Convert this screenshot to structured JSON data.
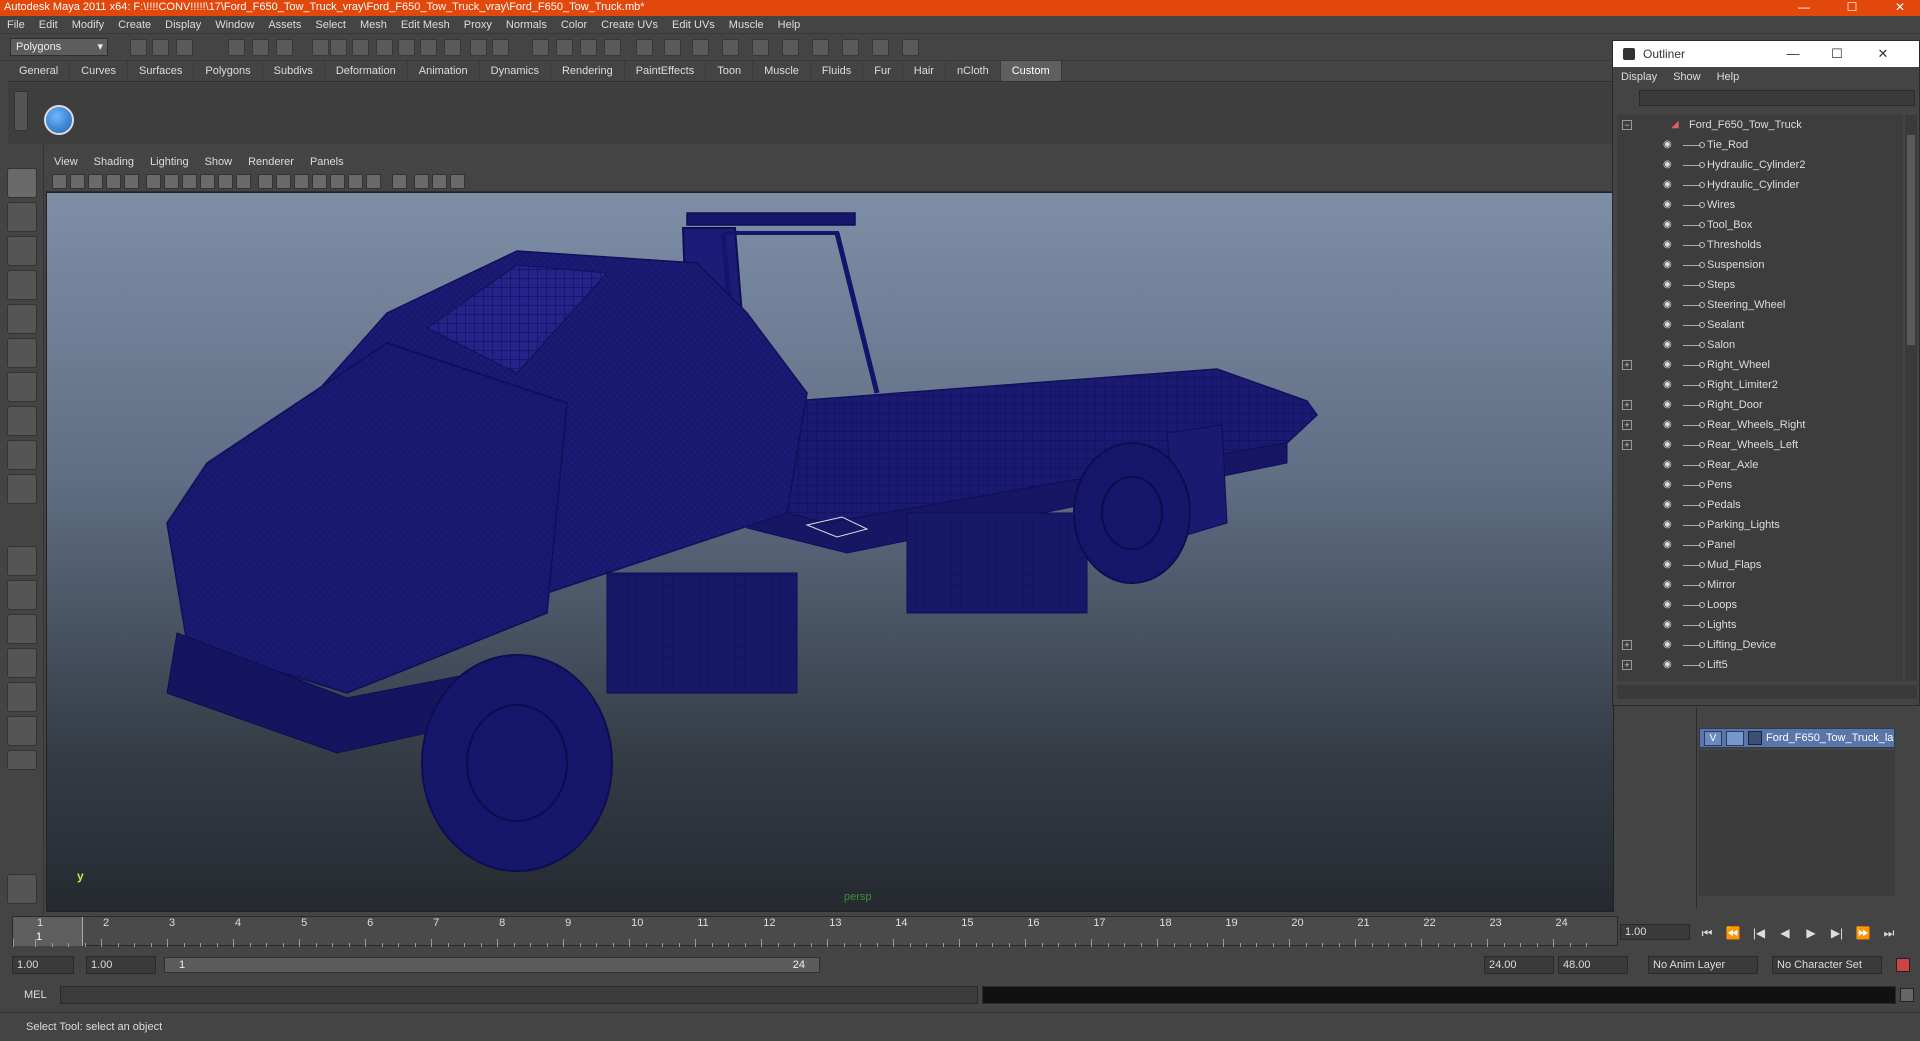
{
  "window": {
    "title": "Autodesk Maya 2011 x64: F:\\!!!!CONV!!!!!\\17\\Ford_F650_Tow_Truck_vray\\Ford_F650_Tow_Truck_vray\\Ford_F650_Tow_Truck.mb*",
    "minimize": "—",
    "maximize": "☐",
    "close": "✕"
  },
  "menubar": [
    "File",
    "Edit",
    "Modify",
    "Create",
    "Display",
    "Window",
    "Assets",
    "Select",
    "Mesh",
    "Edit Mesh",
    "Proxy",
    "Normals",
    "Color",
    "Create UVs",
    "Edit UVs",
    "Muscle",
    "Help"
  ],
  "status_line": {
    "mode": "Polygons"
  },
  "shelf": {
    "tabs": [
      "General",
      "Curves",
      "Surfaces",
      "Polygons",
      "Subdivs",
      "Deformation",
      "Animation",
      "Dynamics",
      "Rendering",
      "PaintEffects",
      "Toon",
      "Muscle",
      "Fluids",
      "Fur",
      "Hair",
      "nCloth",
      "Custom"
    ],
    "active_tab": "Custom"
  },
  "viewport": {
    "menu": [
      "View",
      "Shading",
      "Lighting",
      "Show",
      "Renderer",
      "Panels"
    ],
    "camera_label": "persp",
    "axis_label": "y",
    "wire_color": "#1a1a6e"
  },
  "outliner": {
    "title": "Outliner",
    "menu": [
      "Display",
      "Show",
      "Help"
    ],
    "root": "Ford_F650_Tow_Truck",
    "items": [
      {
        "label": "Tie_Rod",
        "expandable": false
      },
      {
        "label": "Hydraulic_Cylinder2",
        "expandable": false
      },
      {
        "label": "Hydraulic_Cylinder",
        "expandable": false
      },
      {
        "label": "Wires",
        "expandable": false
      },
      {
        "label": "Tool_Box",
        "expandable": false
      },
      {
        "label": "Thresholds",
        "expandable": false
      },
      {
        "label": "Suspension",
        "expandable": false
      },
      {
        "label": "Steps",
        "expandable": false
      },
      {
        "label": "Steering_Wheel",
        "expandable": false
      },
      {
        "label": "Sealant",
        "expandable": false
      },
      {
        "label": "Salon",
        "expandable": false
      },
      {
        "label": "Right_Wheel",
        "expandable": true
      },
      {
        "label": "Right_Limiter2",
        "expandable": false
      },
      {
        "label": "Right_Door",
        "expandable": true
      },
      {
        "label": "Rear_Wheels_Right",
        "expandable": true
      },
      {
        "label": "Rear_Wheels_Left",
        "expandable": true
      },
      {
        "label": "Rear_Axle",
        "expandable": false
      },
      {
        "label": "Pens",
        "expandable": false
      },
      {
        "label": "Pedals",
        "expandable": false
      },
      {
        "label": "Parking_Lights",
        "expandable": false
      },
      {
        "label": "Panel",
        "expandable": false
      },
      {
        "label": "Mud_Flaps",
        "expandable": false
      },
      {
        "label": "Mirror",
        "expandable": false
      },
      {
        "label": "Loops",
        "expandable": false
      },
      {
        "label": "Lights",
        "expandable": false
      },
      {
        "label": "Lifting_Device",
        "expandable": true
      },
      {
        "label": "Lift5",
        "expandable": true
      }
    ]
  },
  "layers": {
    "visible_flag": "V",
    "name": "Ford_F650_Tow_Truck_la"
  },
  "timeline": {
    "ticks": [
      "1",
      "2",
      "3",
      "4",
      "5",
      "6",
      "7",
      "8",
      "9",
      "10",
      "11",
      "12",
      "13",
      "14",
      "15",
      "16",
      "17",
      "18",
      "19",
      "20",
      "21",
      "22",
      "23",
      "24"
    ],
    "current_frame": "1",
    "current_time_field": "1.00",
    "playback_buttons": [
      "⏮",
      "⏪",
      "|◀",
      "◀",
      "▶",
      "▶|",
      "⏩",
      "⏭"
    ]
  },
  "range": {
    "start_time": "1.00",
    "playback_start": "1.00",
    "slider_start": "1",
    "slider_end": "24",
    "playback_end": "24.00",
    "end_time": "48.00",
    "anim_layer": "No Anim Layer",
    "character_set": "No Character Set"
  },
  "command_line": {
    "label": "MEL"
  },
  "help_line": "Select Tool: select an object"
}
